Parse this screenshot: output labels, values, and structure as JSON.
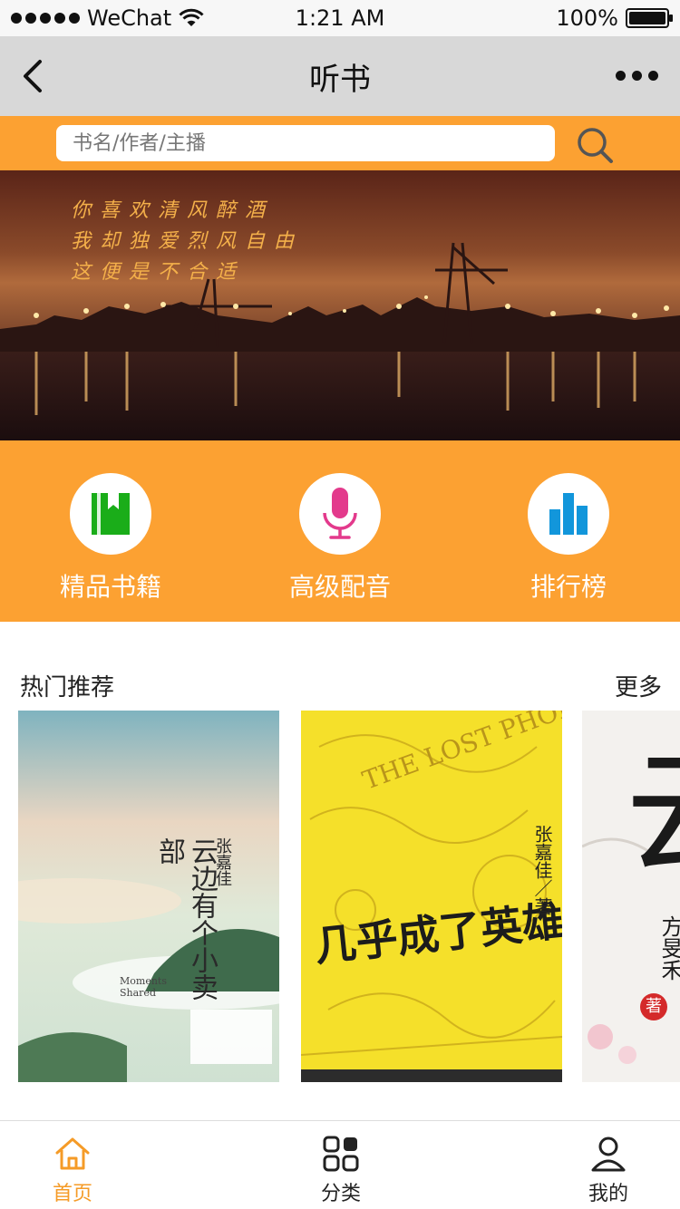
{
  "status_bar": {
    "carrier": "WeChat",
    "time": "1:21 AM",
    "battery": "100%"
  },
  "navbar": {
    "title": "听书"
  },
  "search": {
    "placeholder": "书名/作者/主播"
  },
  "banner": {
    "lines": [
      "你喜欢清风醉酒",
      "我却独爱烈风自由",
      "这便是不合适"
    ]
  },
  "categories": [
    {
      "label": "精品书籍",
      "icon": "book-icon",
      "color": "#1aad19"
    },
    {
      "label": "高级配音",
      "icon": "microphone-icon",
      "color": "#e33a8c"
    },
    {
      "label": "排行榜",
      "icon": "bar-chart-icon",
      "color": "#1296db"
    }
  ],
  "section": {
    "title": "热门推荐",
    "more": "更多"
  },
  "books": [
    {
      "title": "云边有个小卖部",
      "author": "张嘉佳",
      "english": "Moments Shared"
    },
    {
      "title": "几乎成了英雄",
      "author": "张嘉佳／著",
      "english": "THE LOST PHOENIX"
    },
    {
      "title": "云",
      "author": "方旻禾",
      "badge": "著"
    }
  ],
  "tabbar": [
    {
      "label": "首页",
      "icon": "home-icon",
      "active": true
    },
    {
      "label": "分类",
      "icon": "grid-icon",
      "active": false
    },
    {
      "label": "我的",
      "icon": "user-icon",
      "active": false
    }
  ],
  "colors": {
    "accent": "#fca132",
    "active_tab": "#f59b27",
    "navbar_bg": "#d8d8d8"
  }
}
